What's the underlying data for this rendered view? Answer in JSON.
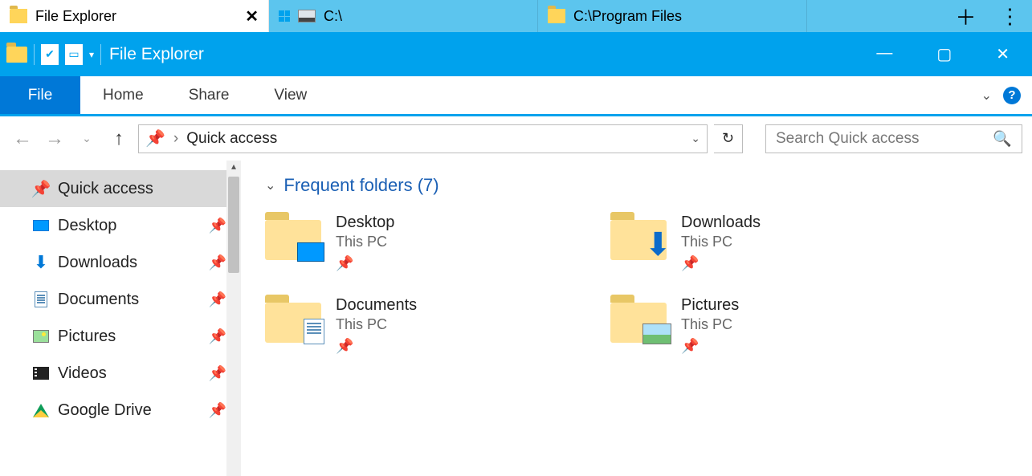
{
  "tabs": [
    {
      "label": "File Explorer",
      "icon": "folder",
      "active": true
    },
    {
      "label": "C:\\",
      "icon": "drive",
      "active": false
    },
    {
      "label": "C:\\Program Files",
      "icon": "folder",
      "active": false
    }
  ],
  "title_bar": {
    "title": "File Explorer"
  },
  "ribbon": {
    "file": "File",
    "tabs": [
      "Home",
      "Share",
      "View"
    ]
  },
  "nav": {
    "address": "Quick access",
    "search_placeholder": "Search Quick access"
  },
  "sidebar": {
    "items": [
      {
        "label": "Quick access",
        "icon": "star",
        "pinned": false,
        "selected": true
      },
      {
        "label": "Desktop",
        "icon": "desk",
        "pinned": true,
        "selected": false
      },
      {
        "label": "Downloads",
        "icon": "down",
        "pinned": true,
        "selected": false
      },
      {
        "label": "Documents",
        "icon": "doc",
        "pinned": true,
        "selected": false
      },
      {
        "label": "Pictures",
        "icon": "pic",
        "pinned": true,
        "selected": false
      },
      {
        "label": "Videos",
        "icon": "vid",
        "pinned": true,
        "selected": false
      },
      {
        "label": "Google Drive",
        "icon": "gd",
        "pinned": true,
        "selected": false
      }
    ]
  },
  "content": {
    "group_label": "Frequent folders (7)",
    "folders": [
      {
        "name": "Desktop",
        "location": "This PC",
        "overlay": "desk"
      },
      {
        "name": "Downloads",
        "location": "This PC",
        "overlay": "down"
      },
      {
        "name": "Documents",
        "location": "This PC",
        "overlay": "doc"
      },
      {
        "name": "Pictures",
        "location": "This PC",
        "overlay": "pic"
      }
    ]
  }
}
